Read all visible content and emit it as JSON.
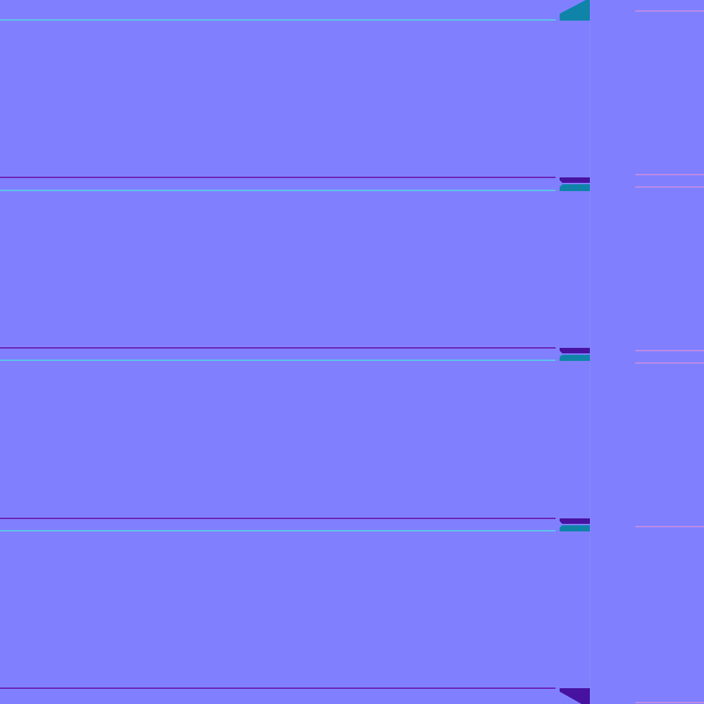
{
  "colors": {
    "base": "#8080ff",
    "edge_top": "#5ac8e8",
    "edge_bottom": "#6a1fb0",
    "cap_top": "#0f84a8",
    "cap_bottom": "#4812a0",
    "strip_line": "#d88ce0",
    "seam": "#8a88f8"
  },
  "panel_count": 4
}
